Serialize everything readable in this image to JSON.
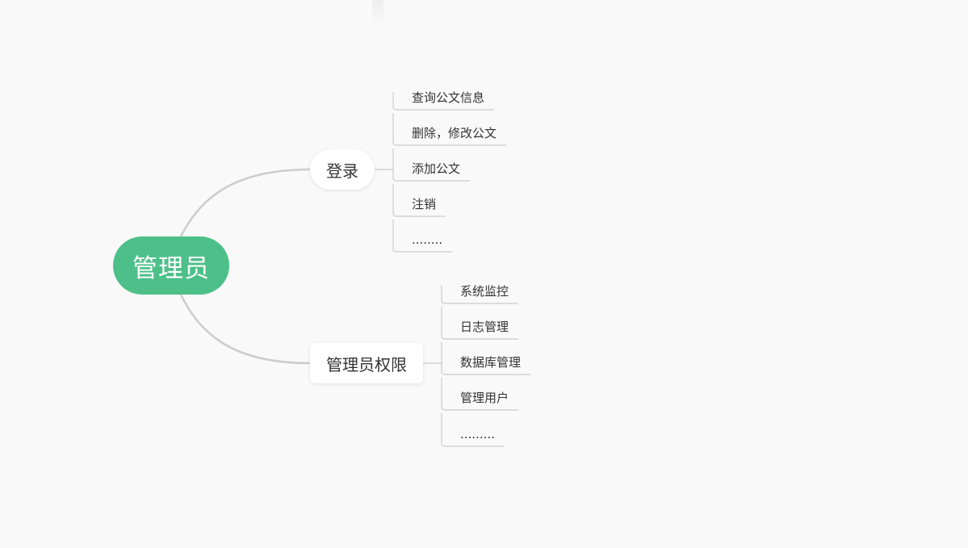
{
  "root": {
    "label": "管理员"
  },
  "branches": [
    {
      "label": "登录",
      "children": [
        "查询公文信息",
        "删除，修改公文",
        "添加公文",
        "注销",
        "........"
      ]
    },
    {
      "label": "管理员权限",
      "children": [
        "系统监控",
        "日志管理",
        "数据库管理",
        "管理用户",
        "........."
      ]
    }
  ],
  "colors": {
    "root": "#4dc089",
    "connector": "#cccccc",
    "background": "#f9f9f9",
    "text": "#333333"
  }
}
